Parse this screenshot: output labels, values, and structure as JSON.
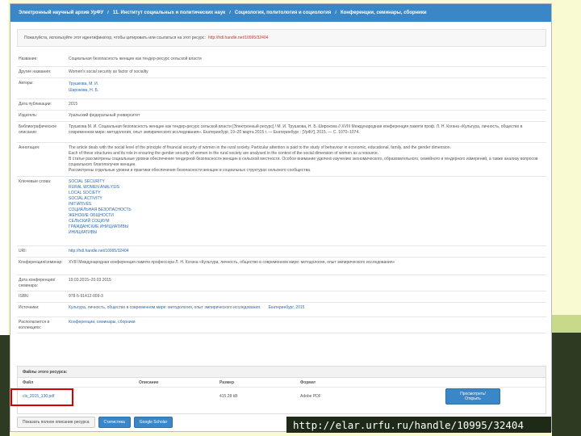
{
  "breadcrumb": [
    "Электронный научный архив УрФУ",
    "11. Институт социальных и политических наук",
    "Социология, политология и социология",
    "Конференции, семинары, сборники"
  ],
  "notice": {
    "text": "Пожалуйста, используйте этот идентификатор, чтобы цитировать или ссылаться на этот ресурс:",
    "link": "http://hdl.handle.net/10995/32404"
  },
  "meta": [
    {
      "label": "Название:",
      "value": "Социальная безопасность женщин как тендер-ресурс сельской власти"
    },
    {
      "label": "Другие названия:",
      "value": "Women's social security as factor of sociality"
    },
    {
      "label": "Авторы:",
      "authors": [
        "Трушкова, М. И.",
        "Широкова, Н. Б."
      ]
    },
    {
      "label": "Дата публикации:",
      "value": "2015"
    },
    {
      "label": "Издатель:",
      "value": "Уральский федеральный университет"
    },
    {
      "label": "Библиографическое описание:",
      "value": "Трушкова М. И. Социальная безопасность женщин как тендер-ресурс сельской власти [Электронный ресурс] / М. И. Трушкова, Н. Б. Широкова // XVIII Международная конференция памяти проф. Л. Н. Когана «Культура, личность, общество в современном мире: методология, опыт эмпирического исследования». Екатеринбург, 19–20 марта 2015 г. — Екатеринбург : [УрФУ], 2015. — С. 1070–1074."
    },
    {
      "label": "Аннотация:",
      "paras": [
        "The article deals with the social level of the principle of financial security of women in the rural society. Particular attention is paid to the study of behaviour in economic, educational, family, and the gender dimension.",
        "Each of these structures and its role in ensuring the gender security of women in the rural society are analysed in the context of the social dimension of women as a resource.",
        "В статье рассмотрены социальные уровни обеспечения тендерной безопасности женщин в сельской местности. Особое внимание уделено изучению экономического, образовательного, семейного и гендерного измерений, а также анализу вопросов социального благополучия женщин.",
        "Рассмотрены отдельные уровни и практики обеспечения безопасности женщин в социальных структурах сельского сообщества."
      ]
    },
    {
      "label": "Ключевые слова:",
      "keywords": [
        "SOCIAL SECURITY",
        "RURAL WOMEN ANALYSIS",
        "LOCAL SOCIETY",
        "SOCIAL ACTIVITY",
        "INITIATIVES",
        "СОЦИАЛЬНАЯ БЕЗОПАСНОСТЬ",
        "ЖЕНСКИЕ ОБЩНОСТИ",
        "СЕЛЬСКИЙ СОЦИУМ",
        "ГРАЖДАНСКИЕ ИНИЦИАТИВЫ",
        "ИНИЦИАТИВЫ"
      ]
    },
    {
      "label": "URI:",
      "value": "http://hdl.handle.net/10995/32404"
    },
    {
      "label": "Конференция/семинар:",
      "value": "XVIII Международная конференция памяти профессора Л. Н. Когана «Культура, личность, общество в современном мире: методология, опыт эмпирического исследования»"
    },
    {
      "label": "Дата конференции/семинара:",
      "value": "19.03.2015–20.03.2015"
    },
    {
      "label": "ISBN:",
      "value": "978-5-91412-009-3"
    },
    {
      "label": "Источники:",
      "value": "Культура, личность, общество в современном мире: методология, опыт эмпирического исследования.",
      "extra": "Екатеринбург, 2015"
    },
    {
      "label": "Располагается в коллекциях:",
      "value": "Конференции, семинары, сборники"
    }
  ],
  "files": {
    "heading": "Файлы этого ресурса:",
    "cols": [
      "Файл",
      "Описание",
      "Размер",
      "Формат"
    ],
    "row": {
      "file": "cls_2015_130.pdf",
      "description": "",
      "size": "415.28 kB",
      "format": "Adobe PDF",
      "action": "Просмотреть/Открыть"
    }
  },
  "bottom": {
    "show_full": "Показать полное описание ресурса",
    "stats": "Статистика",
    "scholar": "Google Scholar"
  },
  "url_caption": "http://elar.urfu.ru/handle/10995/32404"
}
